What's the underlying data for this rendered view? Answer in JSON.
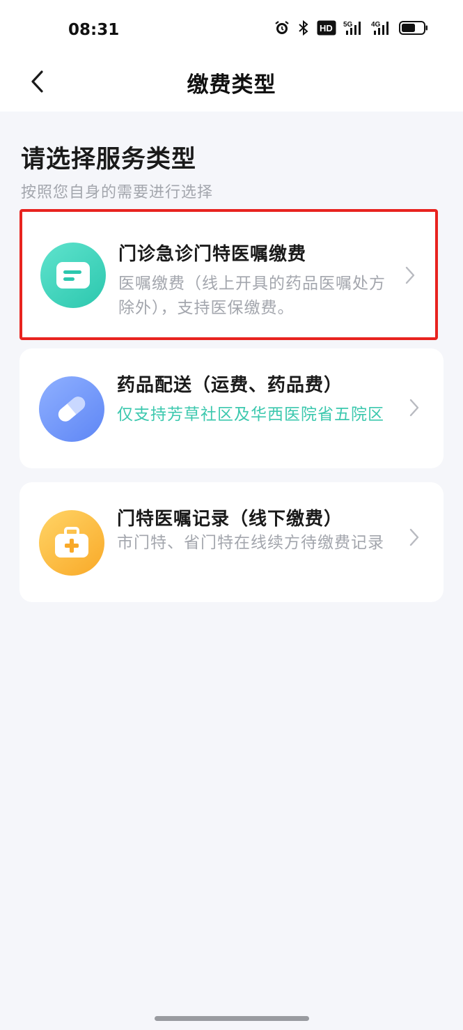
{
  "status_bar": {
    "time": "08:31",
    "icons": [
      "alarm-icon",
      "bluetooth-icon",
      "hd-icon",
      "signal-5g-icon",
      "signal-4g-icon",
      "battery-icon"
    ],
    "hd_label": "HD",
    "net1": "5G",
    "net2": "4G",
    "battery_level": 0.55
  },
  "nav": {
    "title": "缴费类型"
  },
  "section": {
    "title": "请选择服务类型",
    "subtitle": "按照您自身的需要进行选择"
  },
  "cards": [
    {
      "title": "门诊急诊门特医嘱缴费",
      "desc": "医嘱缴费（线上开具的药品医嘱处方除外），支持医保缴费。",
      "icon": "order-doc-icon",
      "color": "#2cc7ae",
      "selected": true
    },
    {
      "title": "药品配送（运费、药品费）",
      "desc": "仅支持芳草社区及华西医院省五院区",
      "icon": "pill-icon",
      "color": "#5e86f5",
      "desc_color": "#3cc8ae"
    },
    {
      "title": "门特医嘱记录（线下缴费）",
      "desc": "市门特、省门特在线续方待缴费记录",
      "icon": "medical-kit-icon",
      "color": "#f9a928"
    }
  ],
  "colors": {
    "highlight_border": "#e8231f",
    "background": "#f5f6fa"
  }
}
